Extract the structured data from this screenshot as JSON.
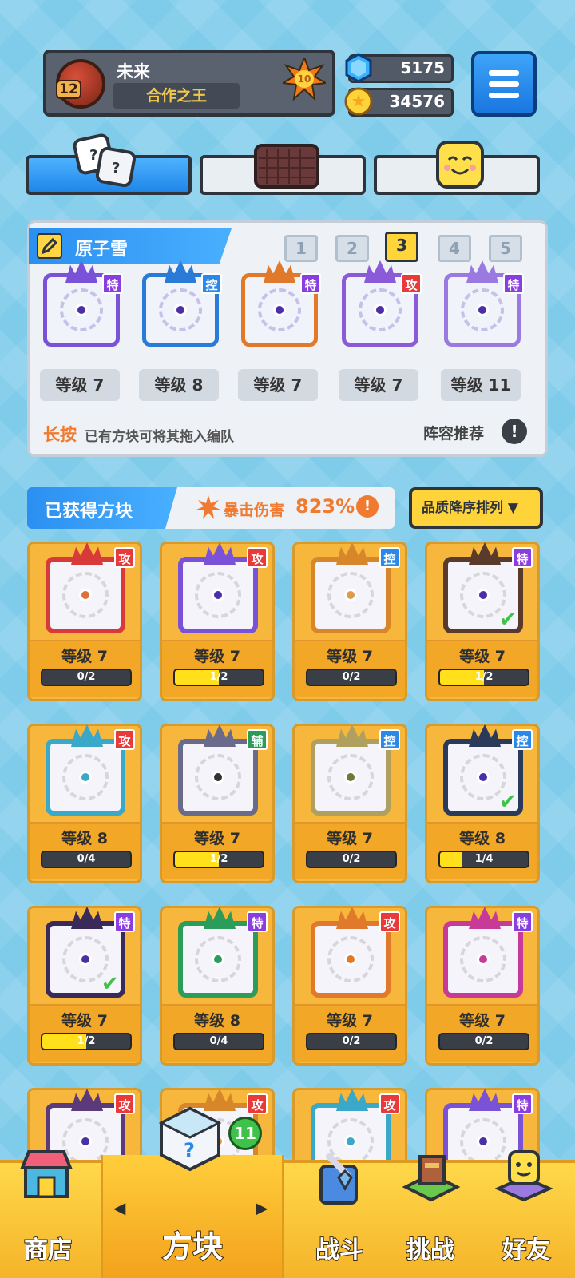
{
  "player": {
    "name": "未来",
    "title": "合作之王",
    "level": "12",
    "rank": "10"
  },
  "currency": {
    "gems": "5175",
    "coins": "34576"
  },
  "deck": {
    "name": "原子雪",
    "pages": [
      "1",
      "2",
      "3",
      "4",
      "5"
    ],
    "active_page": "3",
    "slots": [
      {
        "type": "特",
        "level": "等级 7",
        "color": "#7a52d8"
      },
      {
        "type": "控",
        "level": "等级 8",
        "color": "#2a7ad8"
      },
      {
        "type": "特",
        "level": "等级 7",
        "color": "#e07a2a"
      },
      {
        "type": "攻",
        "level": "等级 7",
        "color": "#8a5ad8"
      },
      {
        "type": "特",
        "level": "等级 11",
        "color": "#9a7ae0"
      }
    ],
    "hint_key": "长按",
    "hint_text": "已有方块可将其拖入编队",
    "recommend": "阵容推荐",
    "recommend_icon": "!"
  },
  "collection": {
    "title": "已获得方块",
    "crit_label": "暴击伤害",
    "crit_value": "823%",
    "sort_label": "品质降序排列 ▼",
    "cards": [
      {
        "type": "攻",
        "level": "等级 7",
        "progress": "0/2",
        "ratio": 0,
        "color": "#d83a3a",
        "dot": "#e0703a",
        "check": false
      },
      {
        "type": "攻",
        "level": "等级 7",
        "progress": "1/2",
        "ratio": 0.5,
        "color": "#7a52d8",
        "dot": "#4b2fa8",
        "check": false
      },
      {
        "type": "控",
        "level": "等级 7",
        "progress": "0/2",
        "ratio": 0,
        "color": "#d8862a",
        "dot": "#e09a50",
        "check": false
      },
      {
        "type": "特",
        "level": "等级 7",
        "progress": "1/2",
        "ratio": 0.5,
        "color": "#5a3a2a",
        "dot": "#4b2fa8",
        "check": true
      },
      {
        "type": "攻",
        "level": "等级 8",
        "progress": "0/4",
        "ratio": 0,
        "color": "#3aa8c8",
        "dot": "#3aa8c8",
        "check": false
      },
      {
        "type": "辅",
        "level": "等级 7",
        "progress": "1/2",
        "ratio": 0.5,
        "color": "#6a6a8a",
        "dot": "#333333",
        "check": false
      },
      {
        "type": "控",
        "level": "等级 7",
        "progress": "0/2",
        "ratio": 0,
        "color": "#b0a060",
        "dot": "#6a7a3a",
        "check": false
      },
      {
        "type": "控",
        "level": "等级 8",
        "progress": "1/4",
        "ratio": 0.25,
        "color": "#2a3a5a",
        "dot": "#4b2fa8",
        "check": true
      },
      {
        "type": "特",
        "level": "等级 7",
        "progress": "1/2",
        "ratio": 0.5,
        "color": "#3a2a5a",
        "dot": "#4b2fa8",
        "check": true
      },
      {
        "type": "特",
        "level": "等级 8",
        "progress": "0/4",
        "ratio": 0,
        "color": "#2c9c5a",
        "dot": "#2c9c5a",
        "check": false
      },
      {
        "type": "攻",
        "level": "等级 7",
        "progress": "0/2",
        "ratio": 0,
        "color": "#e07a2a",
        "dot": "#e07a2a",
        "check": false
      },
      {
        "type": "特",
        "level": "等级 7",
        "progress": "0/2",
        "ratio": 0,
        "color": "#c83a9a",
        "dot": "#c83a9a",
        "check": false
      },
      {
        "type": "攻",
        "color": "#5a3a7a",
        "dot": "#4b2fa8"
      },
      {
        "type": "攻",
        "color": "#d8862a",
        "dot": "#e09a50"
      },
      {
        "type": "攻",
        "color": "#3aa8c8",
        "dot": "#3aa8c8"
      },
      {
        "type": "特",
        "color": "#7a52d8",
        "dot": "#4b2fa8"
      }
    ]
  },
  "nav": {
    "shop": "商店",
    "blocks": "方块",
    "battle": "战斗",
    "challenge": "挑战",
    "friends": "好友",
    "blocks_badge": "11"
  }
}
